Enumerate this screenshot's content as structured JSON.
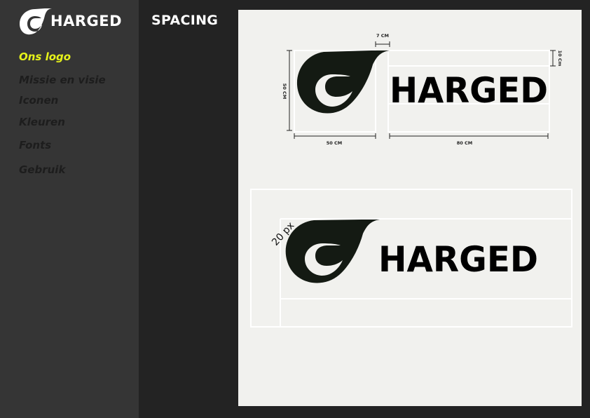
{
  "brand": {
    "name": "HARGED"
  },
  "sidebar": {
    "items": [
      {
        "label": "Ons logo",
        "active": true
      },
      {
        "label": "Missie en visie",
        "active": false
      },
      {
        "label": "Iconen",
        "active": false
      },
      {
        "label": "Kleuren",
        "active": false
      },
      {
        "label": "Fonts",
        "active": false
      },
      {
        "label": "Gebruik",
        "active": false
      }
    ]
  },
  "main": {
    "title": "SPACING",
    "diagram1": {
      "wordmark": "HARGED",
      "dim_top": "7 CM",
      "dim_right": "10 Cm",
      "dim_left": "50 CM",
      "dim_bottom_left": "50 CM",
      "dim_bottom_right": "80 CM"
    },
    "diagram2": {
      "wordmark": "HARGED",
      "spacing_label": "20 px"
    }
  },
  "colors": {
    "accent": "#e6f21a",
    "logo_dark": "#141a13",
    "sidebar_bg": "#353535",
    "page_bg": "#232323",
    "canvas_bg": "#f1f1ee"
  }
}
